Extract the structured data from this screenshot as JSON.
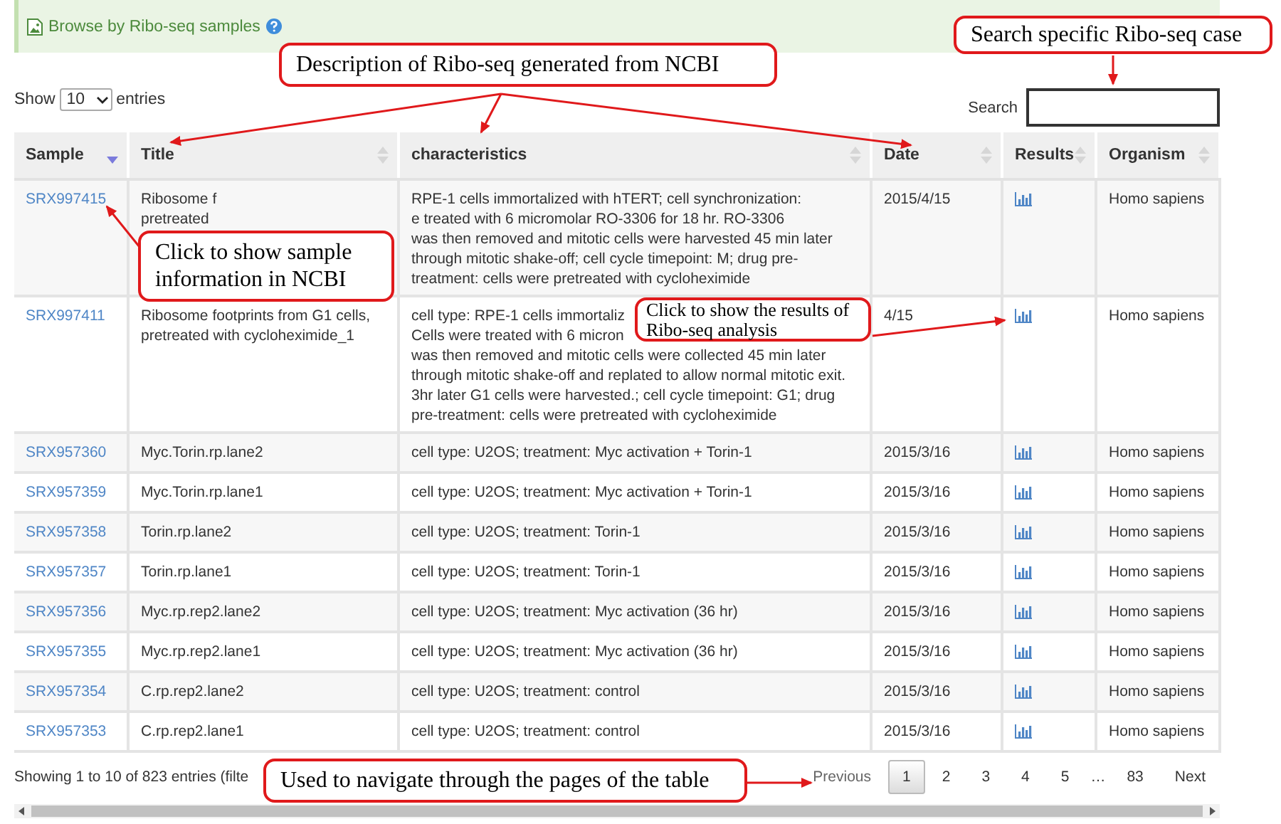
{
  "banner": {
    "title": "Browse by Ribo-seq samples"
  },
  "length_menu": {
    "label_before": "Show",
    "value": "10",
    "label_after": "entries"
  },
  "search": {
    "label": "Search"
  },
  "table": {
    "columns": [
      {
        "label": "Sample",
        "sorted": true
      },
      {
        "label": "Title",
        "sorted": false
      },
      {
        "label": "characteristics",
        "sorted": false
      },
      {
        "label": "Date",
        "sorted": false
      },
      {
        "label": "Results",
        "sorted": false
      },
      {
        "label": "Organism",
        "sorted": false
      }
    ],
    "rows": [
      {
        "sample": "SRX997415",
        "title": [
          "Ribosome f",
          "pretreated"
        ],
        "characteristics": [
          "RPE-1 cells immortalized with hTERT; cell synchronization:",
          "e treated with 6 micromolar RO-3306 for 18 hr. RO-3306",
          "was then removed and mitotic cells were harvested 45 min later",
          "through mitotic shake-off; cell cycle timepoint: M; drug pre-",
          "treatment: cells were pretreated with cycloheximide"
        ],
        "date": "2015/4/15",
        "organism": "Homo sapiens"
      },
      {
        "sample": "SRX997411",
        "title": [
          "Ribosome footprints from G1 cells,",
          "pretreated with cycloheximide_1"
        ],
        "characteristics": [
          "cell type: RPE-1 cells immortaliz",
          "Cells were treated with 6 micron",
          "was then removed and mitotic cells were collected 45 min later",
          "through mitotic shake-off and replated to allow normal mitotic exit.",
          "3hr later G1 cells were harvested.; cell cycle timepoint: G1; drug",
          "pre-treatment: cells were pretreated with cycloheximide"
        ],
        "date": "4/15",
        "organism": "Homo sapiens"
      },
      {
        "sample": "SRX957360",
        "title": "Myc.Torin.rp.lane2",
        "characteristics": "cell type: U2OS; treatment: Myc activation + Torin-1",
        "date": "2015/3/16",
        "organism": "Homo sapiens"
      },
      {
        "sample": "SRX957359",
        "title": "Myc.Torin.rp.lane1",
        "characteristics": "cell type: U2OS; treatment: Myc activation + Torin-1",
        "date": "2015/3/16",
        "organism": "Homo sapiens"
      },
      {
        "sample": "SRX957358",
        "title": "Torin.rp.lane2",
        "characteristics": "cell type: U2OS; treatment: Torin-1",
        "date": "2015/3/16",
        "organism": "Homo sapiens"
      },
      {
        "sample": "SRX957357",
        "title": "Torin.rp.lane1",
        "characteristics": "cell type: U2OS; treatment: Torin-1",
        "date": "2015/3/16",
        "organism": "Homo sapiens"
      },
      {
        "sample": "SRX957356",
        "title": "Myc.rp.rep2.lane2",
        "characteristics": "cell type: U2OS; treatment: Myc activation (36 hr)",
        "date": "2015/3/16",
        "organism": "Homo sapiens"
      },
      {
        "sample": "SRX957355",
        "title": "Myc.rp.rep2.lane1",
        "characteristics": "cell type: U2OS; treatment: Myc activation (36 hr)",
        "date": "2015/3/16",
        "organism": "Homo sapiens"
      },
      {
        "sample": "SRX957354",
        "title": "C.rp.rep2.lane2",
        "characteristics": "cell type: U2OS; treatment: control",
        "date": "2015/3/16",
        "organism": "Homo sapiens"
      },
      {
        "sample": "SRX957353",
        "title": "C.rp.rep2.lane1",
        "characteristics": "cell type: U2OS; treatment: control",
        "date": "2015/3/16",
        "organism": "Homo sapiens"
      }
    ]
  },
  "info": "Showing 1 to 10 of 823 entries (filte",
  "pagination": {
    "previous": "Previous",
    "next": "Next",
    "pages": [
      {
        "label": "1",
        "kind": "page",
        "selected": true
      },
      {
        "label": "2",
        "kind": "page",
        "selected": false
      },
      {
        "label": "3",
        "kind": "page",
        "selected": false
      },
      {
        "label": "4",
        "kind": "page",
        "selected": false
      },
      {
        "label": "5",
        "kind": "page",
        "selected": false
      },
      {
        "label": "…",
        "kind": "gap",
        "selected": false
      },
      {
        "label": "83",
        "kind": "page",
        "selected": false
      }
    ]
  },
  "callouts": [
    {
      "text": "Description of Ribo-seq generated from NCBI"
    },
    {
      "text": "Search specific Ribo-seq case"
    },
    {
      "text": "Click to show sample information in NCBI"
    },
    {
      "text": "Click to show the results of Ribo-seq analysis"
    },
    {
      "text": "Used to navigate through the pages of the table"
    }
  ]
}
